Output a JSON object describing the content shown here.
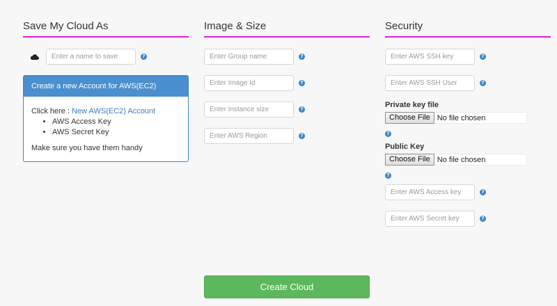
{
  "save_section": {
    "title": "Save My Cloud As",
    "name_placeholder": "Enter a name to save",
    "help": "?",
    "panel": {
      "header": "Create a new Account for AWS(EC2)",
      "click_here": "Click here : ",
      "link_text": "New AWS(EC2) Account",
      "items": [
        "AWS Access Key",
        "AWS Secret Key"
      ],
      "footer": "Make sure you have them handy"
    }
  },
  "image_section": {
    "title": "Image & Size",
    "fields": [
      {
        "placeholder": "Enter Group name"
      },
      {
        "placeholder": "Enter Image Id"
      },
      {
        "placeholder": "Enter Instance size"
      },
      {
        "placeholder": "Enter AWS Region"
      }
    ],
    "help": "?"
  },
  "security_section": {
    "title": "Security",
    "ssh_key_placeholder": "Enter AWS SSH key",
    "ssh_user_placeholder": "Enter AWS SSH User",
    "private_key_label": "Private key file",
    "public_key_label": "Public Key",
    "file_button": "Choose File",
    "file_status": "No file chosen",
    "access_key_placeholder": "Enter AWS Access key",
    "secret_key_placeholder": "Enter AWS Secret key",
    "help": "?"
  },
  "actions": {
    "create_label": "Create Cloud",
    "create_color": "#5cb85c"
  },
  "colors": {
    "heading_underline": "#e31bd7",
    "panel_header": "#4a8fce",
    "help_icon": "#3b87c8",
    "link": "#3a7dbf"
  }
}
